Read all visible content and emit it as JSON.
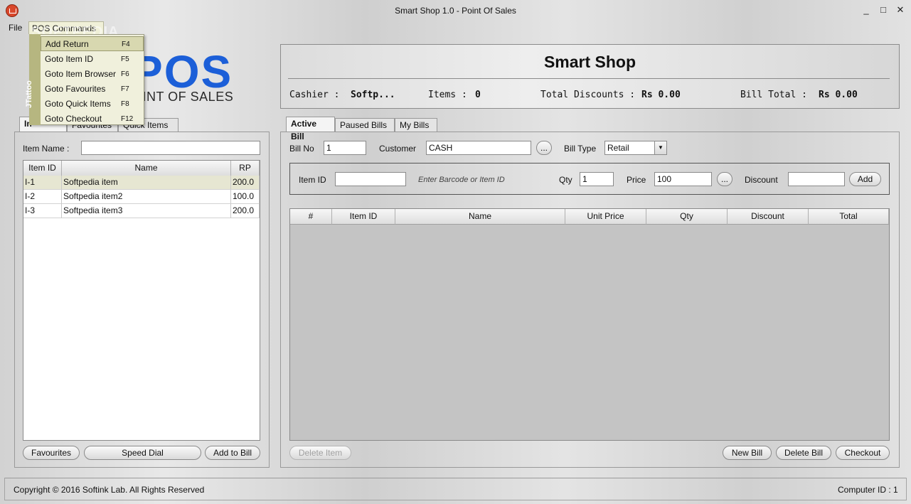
{
  "window": {
    "title": "Smart Shop 1.0 - Point Of Sales",
    "minimize_glyph": "_",
    "maximize_glyph": "□",
    "close_glyph": "✕"
  },
  "menu": {
    "file": "File",
    "pos_commands": "POS Commands",
    "watermark": "SOFTPEDIA"
  },
  "pos_dropdown": {
    "theme_label": "JTattoo",
    "items": [
      {
        "label": "Add Return",
        "shortcut": "F4"
      },
      {
        "label": "Goto Item ID",
        "shortcut": "F5"
      },
      {
        "label": "Goto Item Browser",
        "shortcut": "F6"
      },
      {
        "label": "Goto Favourites",
        "shortcut": "F7"
      },
      {
        "label": "Goto Quick Items",
        "shortcut": "F8"
      },
      {
        "label": "Goto Checkout",
        "shortcut": "F12"
      }
    ]
  },
  "logo": {
    "big": "POS",
    "sub": "OINT OF SALES"
  },
  "header": {
    "shop_name": "Smart Shop",
    "cashier_label": "Cashier :",
    "cashier_value": "Softp...",
    "items_label": "Items :",
    "items_value": "0",
    "discounts_label": "Total Discounts :",
    "discounts_value": "Rs 0.00",
    "bill_total_label": "Bill Total :",
    "bill_total_value": "Rs 0.00"
  },
  "left_tabs": [
    "In",
    "Favourites",
    "Quick Items"
  ],
  "left_panel": {
    "item_name_label": "Item Name :",
    "item_name_value": "",
    "columns": [
      "Item ID",
      "Name",
      "RP"
    ],
    "rows": [
      {
        "id": "I-1",
        "name": "Softpedia item",
        "rp": "200.0"
      },
      {
        "id": "I-2",
        "name": "Softpedia item2",
        "rp": "100.0"
      },
      {
        "id": "I-3",
        "name": "Softpedia item3",
        "rp": "200.0"
      }
    ],
    "btn_favourites": "Favourites",
    "btn_speed_dial": "Speed Dial",
    "btn_add_to_bill": "Add to Bill"
  },
  "right_tabs": [
    "Active Bill",
    "Paused Bills",
    "My Bills"
  ],
  "bill": {
    "bill_no_label": "Bill No",
    "bill_no_value": "1",
    "customer_label": "Customer",
    "customer_value": "CASH",
    "browse_label": "...",
    "bill_type_label": "Bill Type",
    "bill_type_value": "Retail",
    "item_id_label": "Item ID",
    "item_id_value": "",
    "item_id_hint": "Enter Barcode or Item ID",
    "qty_label": "Qty",
    "qty_value": "1",
    "price_label": "Price",
    "price_value": "100",
    "discount_label": "Discount",
    "discount_value": "",
    "add_label": "Add",
    "columns": [
      "#",
      "Item ID",
      "Name",
      "Unit Price",
      "Qty",
      "Discount",
      "Total"
    ],
    "btn_delete_item": "Delete Item",
    "btn_new_bill": "New Bill",
    "btn_delete_bill": "Delete Bill",
    "btn_checkout": "Checkout"
  },
  "status": {
    "copyright": "Copyright © 2016 Softink Lab. All Rights Reserved",
    "computer_id": "Computer ID : 1"
  }
}
